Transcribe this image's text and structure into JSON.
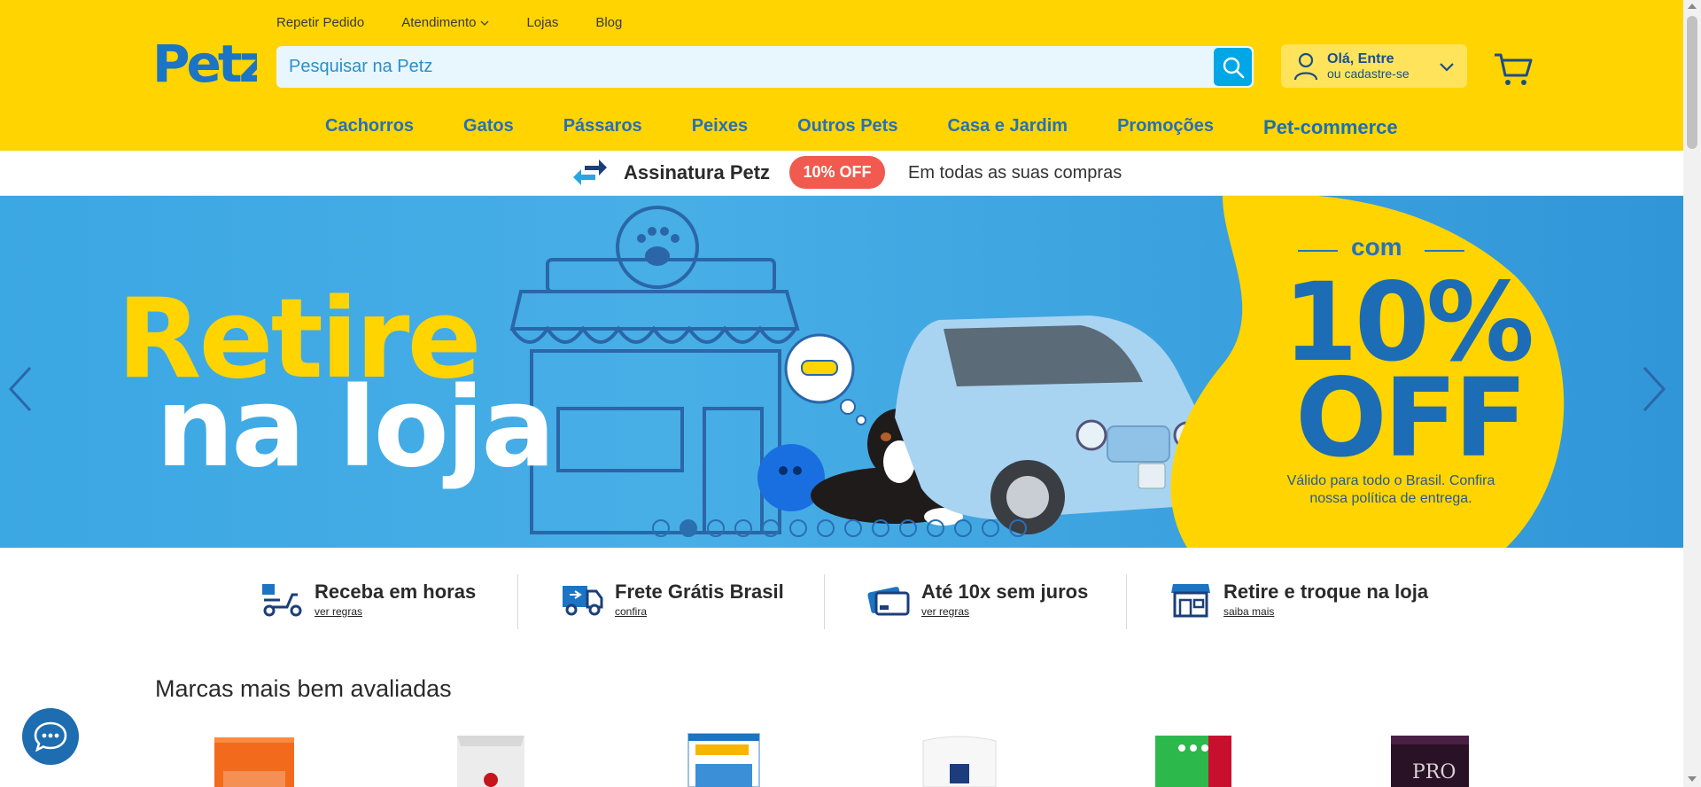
{
  "header": {
    "logo_text": "Petz",
    "top_links": [
      {
        "label": "Repetir Pedido"
      },
      {
        "label": "Atendimento",
        "has_dropdown": true
      },
      {
        "label": "Lojas"
      },
      {
        "label": "Blog"
      }
    ],
    "search": {
      "placeholder": "Pesquisar na Petz",
      "value": ""
    },
    "account": {
      "greeting": "Olá, Entre",
      "subtext": "ou cadastre-se"
    },
    "categories": [
      "Cachorros",
      "Gatos",
      "Pássaros",
      "Peixes",
      "Outros Pets",
      "Casa e Jardim",
      "Promoções",
      "Pet-commerce"
    ]
  },
  "subscription": {
    "title": "Assinatura Petz",
    "badge": "10% OFF",
    "text": "Em todas as suas compras"
  },
  "banner": {
    "headline_line1": "Retire",
    "headline_line2": "na loja",
    "promo_prefix": "com",
    "promo_percent": "10%",
    "promo_off": "OFF",
    "promo_note": "Válido para todo o Brasil. Confira nossa política de entrega.",
    "slide_count": 14,
    "active_slide": 2
  },
  "benefits": [
    {
      "title": "Receba em horas",
      "link": "ver regras",
      "icon": "delivery-scooter-icon"
    },
    {
      "title": "Frete Grátis Brasil",
      "link": "confira",
      "icon": "delivery-truck-icon"
    },
    {
      "title": "Até 10x sem juros",
      "link": "ver regras",
      "icon": "credit-card-icon"
    },
    {
      "title": "Retire e troque na loja",
      "link": "saiba mais",
      "icon": "store-icon"
    }
  ],
  "brands_section": {
    "title": "Marcas mais bem avaliadas"
  },
  "colors": {
    "header_yellow": "#ffd400",
    "brand_blue": "#2670b6",
    "search_button": "#00a7e6",
    "badge_red": "#f05a4f",
    "banner_blue": "#3ba7e3"
  }
}
